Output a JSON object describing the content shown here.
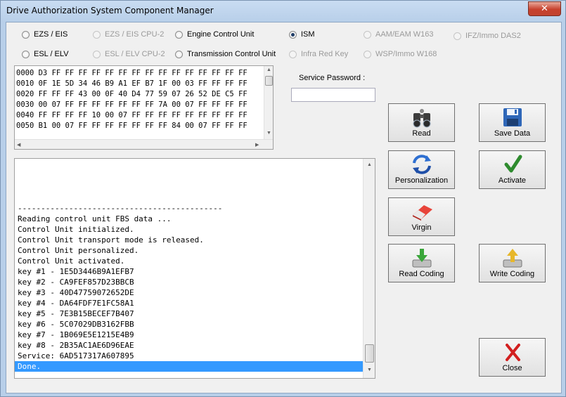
{
  "window": {
    "title": "Drive Authorization System Component Manager",
    "close_glyph": "✕"
  },
  "radios": [
    {
      "id": "ezs-eis",
      "label": "EZS / EIS",
      "checked": false,
      "disabled": false
    },
    {
      "id": "ezs-eis-cpu2",
      "label": "EZS / EIS CPU-2",
      "checked": false,
      "disabled": true
    },
    {
      "id": "engine-control-unit",
      "label": "Engine Control Unit",
      "checked": false,
      "disabled": false
    },
    {
      "id": "ism",
      "label": "ISM",
      "checked": true,
      "disabled": false
    },
    {
      "id": "aam-eam-w163",
      "label": "AAM/EAM W163",
      "checked": false,
      "disabled": true
    },
    {
      "id": "ifz-immo-das2",
      "label": "IFZ/Immo DAS2",
      "checked": false,
      "disabled": true
    },
    {
      "id": "esl-elv",
      "label": "ESL / ELV",
      "checked": false,
      "disabled": false
    },
    {
      "id": "esl-elv-cpu2",
      "label": "ESL / ELV CPU-2",
      "checked": false,
      "disabled": true
    },
    {
      "id": "transmission-control-unit",
      "label": "Transmission Control Unit",
      "checked": false,
      "disabled": false
    },
    {
      "id": "infra-red-key",
      "label": "Infra Red Key",
      "checked": false,
      "disabled": true
    },
    {
      "id": "wsp-immo-w168",
      "label": "WSP/Immo W168",
      "checked": false,
      "disabled": true
    }
  ],
  "hex_dump": [
    "0000 D3 FF FF FF FF FF FF FF FF FF FF FF FF FF FF FF",
    "0010 0F 1E 5D 34 46 B9 A1 EF B7 1F 00 03 FF FF FF FF",
    "0020 FF FF FF 43 00 0F 40 D4 77 59 07 26 52 DE C5 FF",
    "0030 00 07 FF FF FF FF FF FF FF 7A 00 07 FF FF FF FF",
    "0040 FF FF FF FF 10 00 07 FF FF FF FF FF FF FF FF FF",
    "0050 B1 00 07 FF FF FF FF FF FF FF 84 00 07 FF FF FF"
  ],
  "password": {
    "label": "Service Password :",
    "value": ""
  },
  "log": {
    "lines": [
      "--------------------------------------------",
      "Reading control unit FBS data ...",
      "Control Unit initialized.",
      "Control Unit transport mode is released.",
      "Control Unit personalized.",
      "Control Unit activated.",
      "key #1 - 1E5D3446B9A1EFB7",
      "key #2 - CA9FEF857D23BBCB",
      "key #3 - 40D47759072652DE",
      "key #4 - DA64FDF7E1FC58A1",
      "key #5 - 7E3B15BECEF7B407",
      "key #6 - 5C07029DB3162FBB",
      "key #7 - 1B069E5E1215E4B9",
      "key #8 - 2B35AC1AE6D96EAE",
      "Service: 6AD517317A607895",
      "Done."
    ],
    "selected_index": 15
  },
  "buttons": {
    "read": "Read",
    "save_data": "Save Data",
    "personalization": "Personalization",
    "activate": "Activate",
    "virgin": "Virgin",
    "read_coding": "Read Coding",
    "write_coding": "Write Coding",
    "close": "Close"
  },
  "colors": {
    "selection": "#3399ff",
    "activate_check": "#2e8b2e",
    "close_x": "#d21f1f"
  }
}
